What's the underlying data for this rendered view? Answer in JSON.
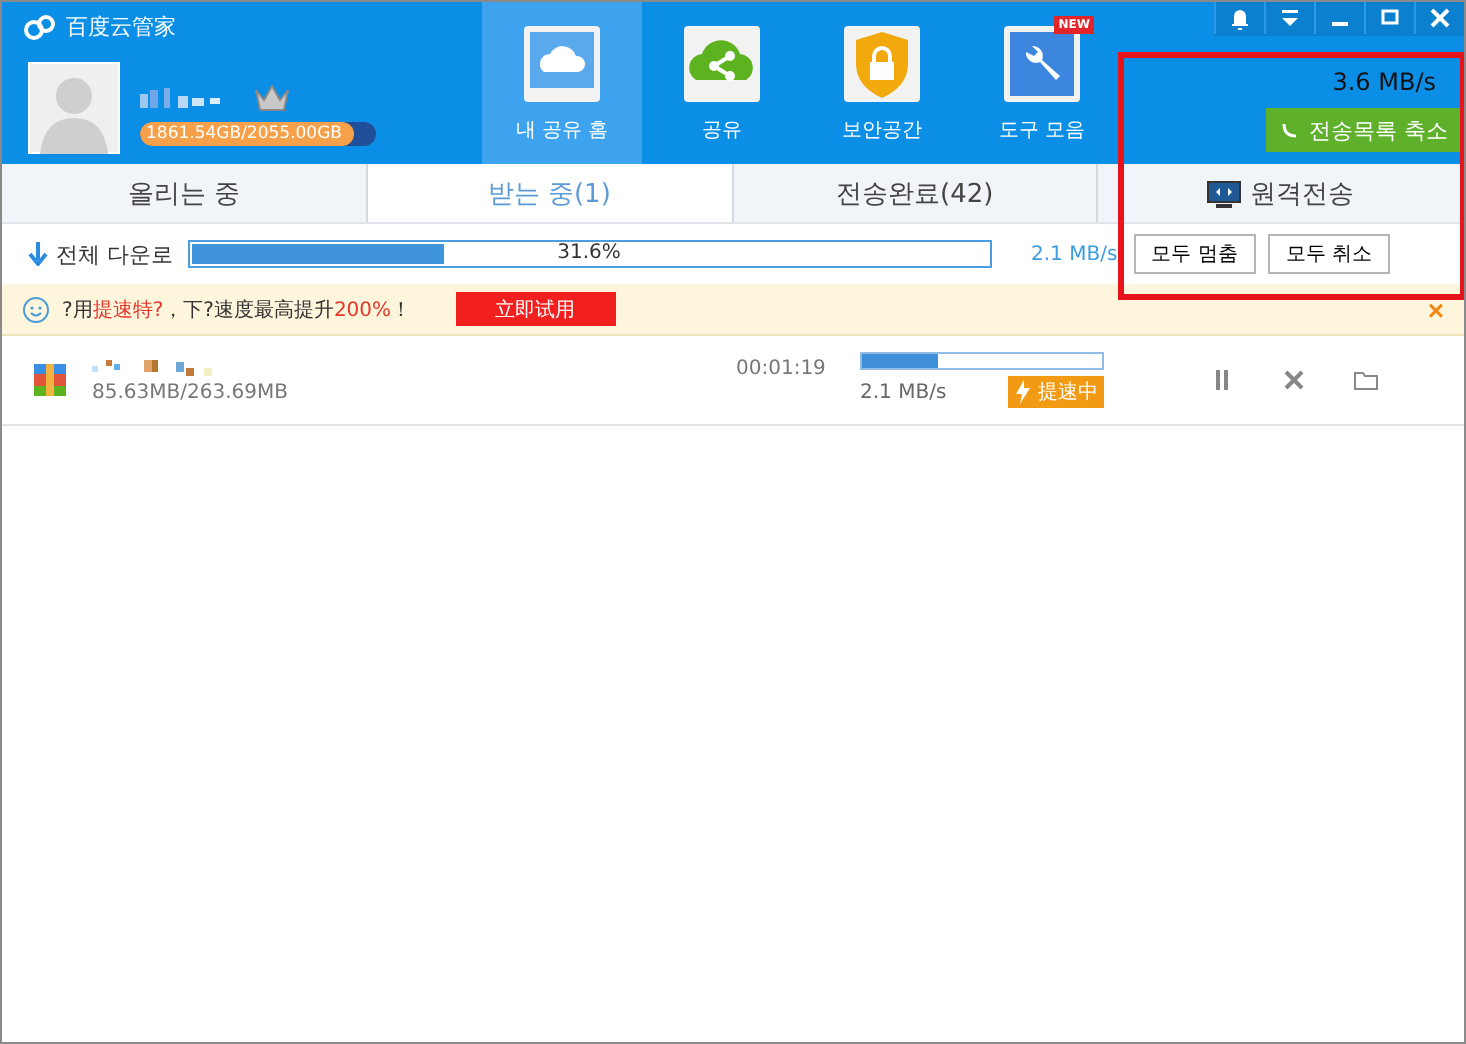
{
  "window": {
    "title": "百度云管家"
  },
  "account": {
    "quota": "1861.54GB/2055.00GB",
    "level": 0.906
  },
  "nav": [
    {
      "label": "내 공유 홈",
      "selected": true
    },
    {
      "label": "공유",
      "selected": false
    },
    {
      "label": "보안공간",
      "selected": false
    },
    {
      "label": "도구 모음",
      "selected": false,
      "badge": "NEW"
    }
  ],
  "speed": "3.6 MB/s",
  "collapse_button": "전송목록 축소",
  "tabs": [
    {
      "label": "올리는 중",
      "selected": false
    },
    {
      "label": "받는 중(1)",
      "selected": true
    },
    {
      "label": "전송완료(42)",
      "selected": false
    },
    {
      "label": "원격전송",
      "selected": false,
      "kind": "remote"
    }
  ],
  "overall": {
    "label": "전체 다운로",
    "level": 0.316,
    "percent": "31.6%",
    "speed": "2.1 MB/s",
    "buttons": [
      "모두 멈춤",
      "모두 취소"
    ]
  },
  "promo": {
    "parts": [
      {
        "text": "?用",
        "highlight": false
      },
      {
        "text": "提速特?",
        "highlight": true
      },
      {
        "text": "，下?速度最高提升",
        "highlight": false
      },
      {
        "text": "200%",
        "highlight": true
      },
      {
        "text": "！",
        "highlight": false
      }
    ],
    "button": "立即试用",
    "close": "×"
  },
  "downloads": [
    {
      "size": "85.63MB/263.69MB",
      "time": "00:01:19",
      "level": 0.32,
      "speed": "2.1 MB/s",
      "badge": "提速中"
    }
  ]
}
